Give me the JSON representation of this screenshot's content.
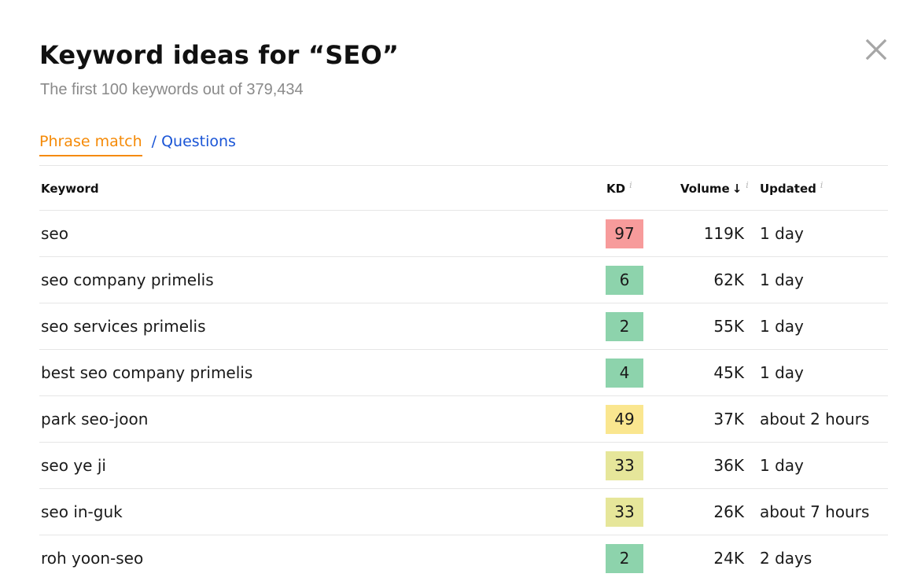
{
  "dialog": {
    "title": "Keyword ideas for “SEO”",
    "subtitle": "The first 100 keywords out of 379,434",
    "close_icon": "close-x-icon"
  },
  "tabs": {
    "active": "Phrase match",
    "separator": "/",
    "other": "Questions"
  },
  "colors": {
    "accent_orange": "#f58a07",
    "link_blue": "#1a55d6",
    "kd_hard": "#f79b9b",
    "kd_easy": "#8dd3ac",
    "kd_medium": "#fae68f",
    "kd_medium_low": "#e6e69a"
  },
  "table": {
    "headers": {
      "keyword": "Keyword",
      "kd": "KD",
      "volume": "Volume",
      "volume_sort_icon": "↓",
      "updated": "Updated",
      "info_icon": "i"
    },
    "rows": [
      {
        "keyword": "seo",
        "kd": "97",
        "kd_color": "#f79b9b",
        "volume": "119K",
        "updated": "1 day"
      },
      {
        "keyword": "seo company primelis",
        "kd": "6",
        "kd_color": "#8dd3ac",
        "volume": "62K",
        "updated": "1 day"
      },
      {
        "keyword": "seo services primelis",
        "kd": "2",
        "kd_color": "#8dd3ac",
        "volume": "55K",
        "updated": "1 day"
      },
      {
        "keyword": "best seo company primelis",
        "kd": "4",
        "kd_color": "#8dd3ac",
        "volume": "45K",
        "updated": "1 day"
      },
      {
        "keyword": "park seo-joon",
        "kd": "49",
        "kd_color": "#fae68f",
        "volume": "37K",
        "updated": "about 2 hours"
      },
      {
        "keyword": "seo ye ji",
        "kd": "33",
        "kd_color": "#e6e69a",
        "volume": "36K",
        "updated": "1 day"
      },
      {
        "keyword": "seo in-guk",
        "kd": "33",
        "kd_color": "#e6e69a",
        "volume": "26K",
        "updated": "about 7 hours"
      },
      {
        "keyword": "roh yoon-seo",
        "kd": "2",
        "kd_color": "#8dd3ac",
        "volume": "24K",
        "updated": "2 days"
      }
    ]
  }
}
